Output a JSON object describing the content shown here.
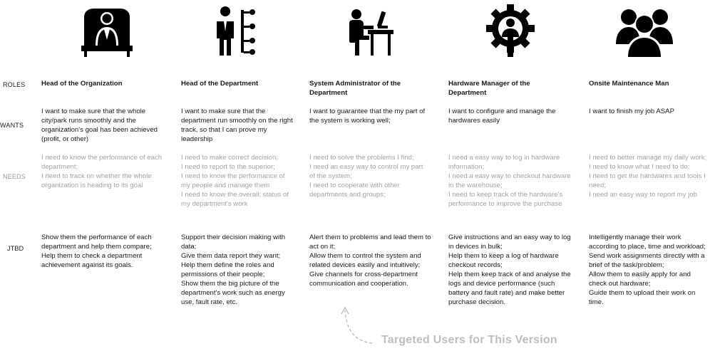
{
  "row_labels": {
    "roles": "ROLES",
    "wants": "WANTS",
    "needs": "NEEDS",
    "jtbd": "JTBD"
  },
  "columns": [
    {
      "icon": "executive-desk-icon",
      "role": "Head of the Organization",
      "wants": "I want to make sure that the whole city/park runs smoothly and the organization's goal has been achieved (profit, or other)",
      "needs": "I need to know the performance of each department;\nI need to track on whether the whole organization is heading to its goal",
      "jtbd": "Show them the performance of each department and help them compare;\nHelp them to check a department achievement against its goals."
    },
    {
      "icon": "manager-hierarchy-icon",
      "role": "Head of the Department",
      "wants": "I want to make sure that the department run smoothly on the right track, so that I can prove my leadership",
      "needs": "I need to make correct decision;\nI need to report to the superior;\nI need to know the performance of my people and manage them\nI need to know the overall; status of my department's work",
      "jtbd": "Support their decision making with data;\nGive them data report they want;\nHelp them define the roles and permissions of their people;\nShow them the big picture of the department's work such as energy use, fault rate, etc."
    },
    {
      "icon": "person-at-computer-icon",
      "role": "System Administrator of the Department",
      "wants": "I want to guarantee that the my part of the system is working well;",
      "needs": "I need to solve the problems I find;\nI need an easy way to control my part of the system;\nI need to cooperate with other departments and groups;",
      "jtbd": "Alert them to problems and lead them to act on it;\nAllow them to control the system and related devices easily and intuitively;\nGive channels for cross-department communication and cooperation."
    },
    {
      "icon": "gear-person-icon",
      "role": "Hardware Manager of the Department",
      "wants": "I want to configure and manage the hardwares easily",
      "needs": "I need a easy way to log in hardware information;\nI need a easy way to checkout hardware in the warehouse;\nI need to keep track of the hardware's performance to improve the purchase",
      "jtbd": "Give instructions and an easy way to log in devices in bulk;\nHelp them to keep a log of hardware checkout records;\nHelp them keep track of and analyse the logs and device performance (such battery and fault rate)  and make better purchase decision."
    },
    {
      "icon": "group-people-icon",
      "role": "Onsite Maintenance Man",
      "wants": "I want to finish my job ASAP",
      "needs": "I need to better manage my daily work;\nI need to know what I need to do;\nI need to get the hardwares and tools I need;\nI need an easy way to report my job",
      "jtbd": "Intelligently manage their work according to place, time and workload;\nSend work assignments directly with a brief of the task/problem;\nAllow them to easily apply for and check out hardware;\nGuide them to upload their work on time."
    }
  ],
  "annotation": {
    "label": "Targeted Users for This Version",
    "arrow_icon": "dashed-curved-arrow-icon"
  }
}
